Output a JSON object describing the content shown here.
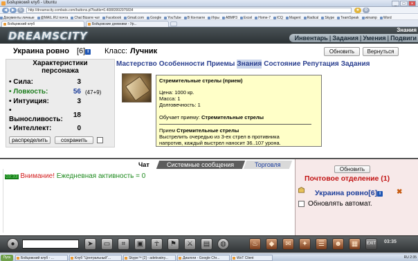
{
  "browser": {
    "window_title": "Бойцовский клуб - Ubuntu",
    "window_controls": [
      "_",
      "□",
      "×"
    ],
    "url": "http://dreamscity.combats.com/buttons.pl?battle=0.40883992975834",
    "bookmarks": [
      "Документы личные",
      "@MAIL.RU почта",
      "Chat Bizarre чат",
      "Facebook",
      "Gmail.com",
      "Google",
      "YouTube",
      "В Контакте",
      "Игры",
      "ABMP3",
      "Excel",
      "Home-7",
      "ICQ",
      "Magent",
      "Radical",
      "Skype",
      "TeamSpeak",
      "winamp",
      "Word"
    ],
    "tabs": [
      "Бойцовский клуб",
      "Бойцовские дневники - Ур..."
    ]
  },
  "game_header": {
    "logo": "DREAMSCITY",
    "menu": [
      "Инвентарь",
      "Задания",
      "Умения",
      "Подвиги"
    ],
    "top_right_label": "Знания"
  },
  "character": {
    "name": "Украина ровно",
    "level": "[6]",
    "info_icon": "i",
    "class_label": "Класс:",
    "class_value": "Лучник",
    "refresh_btn": "Обновить",
    "back_btn": "Вернуться"
  },
  "stats": {
    "title_line1": "Характеристики",
    "title_line2": "персонажа",
    "items": [
      {
        "label": "Сила:",
        "value": "3"
      },
      {
        "label": "Ловкость:",
        "value": "56",
        "extra": "(47+9)"
      },
      {
        "label": "Интуиция:",
        "value": "3"
      },
      {
        "label_line1": "•",
        "label_line2": "Выносливость:",
        "value": "18"
      },
      {
        "label": "Интеллект:",
        "value": "0"
      }
    ],
    "distribute_btn": "распределить",
    "save_btn": "сохранить"
  },
  "skill_tabs": [
    "Мастерство",
    "Особенности",
    "Приемы",
    "Знания",
    "Состояние",
    "Репутация",
    "Задания"
  ],
  "skill_tab_active": "Знания",
  "tooltip": {
    "title": "Стремительные стрелы (прием)",
    "price": "Цена: 1000 кр.",
    "mass": "Масса: 1",
    "durability": "Долговечность: 1",
    "teaches_prefix": "Обучает приему: ",
    "teaches_skill": "Стремительные стрелы",
    "desc_prefix": "Прием ",
    "desc_skill": "Стремительные стрелы",
    "desc_line2": "Выстрелить очередью из 3-ех стрел в противника",
    "desc_line3": "напротив, каждый выстрел наносит 36..107 урона."
  },
  "chat": {
    "tabs": [
      "Чат",
      "Системные сообщения",
      "Торговля"
    ],
    "active_tab": "Чат",
    "time": "03:33",
    "warning": "Внимание!",
    "message": "Ежедневная активность = 0"
  },
  "mail": {
    "refresh_btn": "Обновить",
    "title": "Почтовое отделение (1)",
    "user": "Украина ровно",
    "user_level": "[6]",
    "info_icon": "i",
    "auto_label": "Обновлять автомат."
  },
  "game_toolbar": {
    "clock": "03:35",
    "exit_label": "EXIT"
  },
  "taskbar": {
    "start": "Пуск",
    "tasks": [
      "Бойцовский клуб - ...",
      "Клуб \"Центральный\"...",
      "Skype™ [2] - adekvatny...",
      "Диалоги - Google Chr...",
      "WoT Client"
    ],
    "tray": "RU  2:35"
  }
}
